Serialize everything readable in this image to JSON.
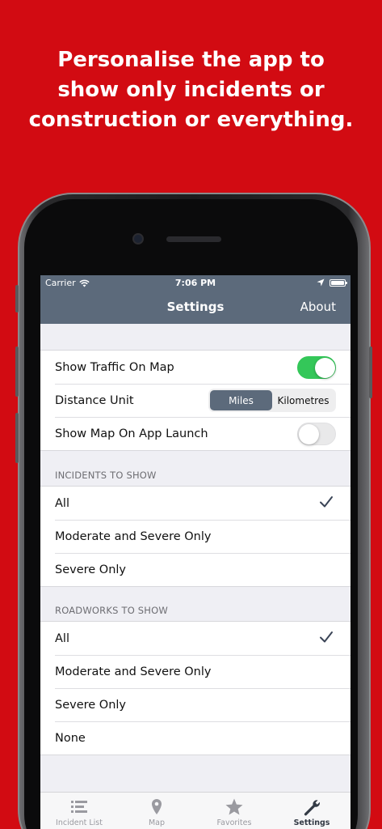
{
  "headline": "Personalise the app to show only incidents or construction or everything.",
  "status": {
    "carrier": "Carrier",
    "time": "7:06 PM"
  },
  "nav": {
    "title": "Settings",
    "about": "About"
  },
  "general": {
    "show_traffic": {
      "label": "Show Traffic On Map",
      "on": true
    },
    "distance_unit": {
      "label": "Distance Unit",
      "options": [
        "Miles",
        "Kilometres"
      ],
      "selected": "Miles"
    },
    "show_map_launch": {
      "label": "Show Map On App Launch",
      "on": false
    }
  },
  "incidents": {
    "header": "INCIDENTS TO SHOW",
    "options": [
      "All",
      "Moderate and Severe Only",
      "Severe Only"
    ],
    "selected": "All"
  },
  "roadworks": {
    "header": "ROADWORKS TO SHOW",
    "options": [
      "All",
      "Moderate and Severe Only",
      "Severe Only",
      "None"
    ],
    "selected": "All"
  },
  "tabs": [
    {
      "label": "Incident List",
      "icon": "list-icon"
    },
    {
      "label": "Map",
      "icon": "map-pin-icon"
    },
    {
      "label": "Favorites",
      "icon": "star-icon"
    },
    {
      "label": "Settings",
      "icon": "wrench-icon"
    }
  ],
  "active_tab": "Settings",
  "colors": {
    "background": "#d20b12",
    "nav": "#5c6a7b",
    "toggle_on": "#34c759",
    "check": "#3a4456"
  }
}
